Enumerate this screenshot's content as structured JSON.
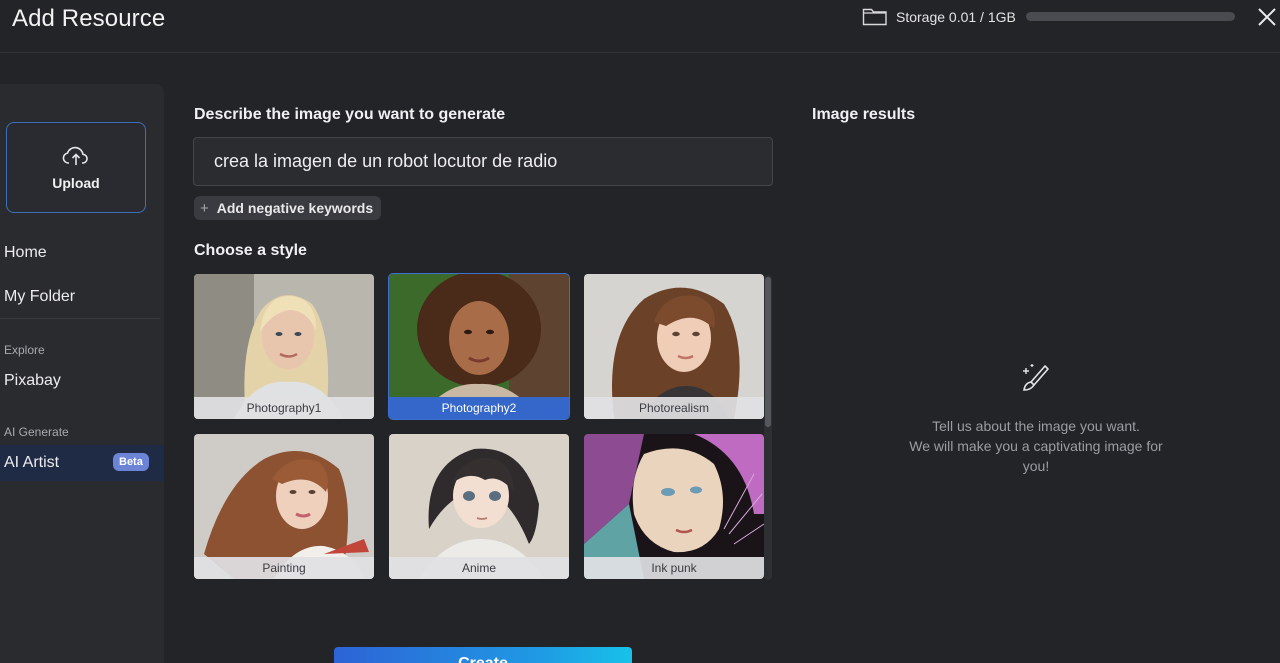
{
  "header": {
    "title": "Add Resource",
    "storage_label": "Storage 0.01 / 1GB",
    "storage_used_fraction": 1e-05
  },
  "sidebar": {
    "upload_label": "Upload",
    "items": [
      {
        "label": "Home"
      },
      {
        "label": "My Folder"
      }
    ],
    "explore_section": "Explore",
    "explore_items": [
      {
        "label": "Pixabay"
      }
    ],
    "generate_section": "AI Generate",
    "generate_items": [
      {
        "label": "AI Artist",
        "badge": "Beta",
        "active": true
      }
    ]
  },
  "generator": {
    "describe_title": "Describe the image you want to generate",
    "prompt_value": "crea la imagen de un robot locutor de radio",
    "negative_keywords_label": "Add negative keywords",
    "style_title": "Choose a style",
    "styles": [
      {
        "label": "Photography1",
        "selected": false
      },
      {
        "label": "Photography2",
        "selected": true
      },
      {
        "label": "Photorealism",
        "selected": false
      },
      {
        "label": "Painting",
        "selected": false
      },
      {
        "label": "Anime",
        "selected": false
      },
      {
        "label": "Ink punk",
        "selected": false
      }
    ],
    "create_label": "Create"
  },
  "results": {
    "title": "Image results",
    "empty_line1": "Tell us about the image you want.",
    "empty_line2": "We will make you a captivating image for you!"
  },
  "colors": {
    "accent": "#3467c9",
    "background": "#232427",
    "sidebar": "#2a2b2f"
  }
}
